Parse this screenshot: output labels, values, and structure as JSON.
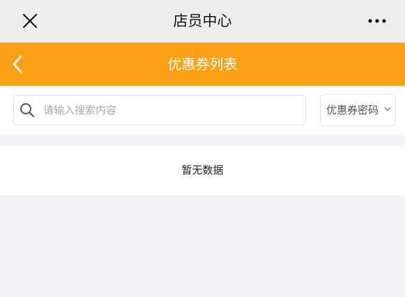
{
  "topbar": {
    "title": "店员中心",
    "close_icon": "close-icon",
    "more_icon": "more-dots-icon"
  },
  "header": {
    "title": "优惠券列表",
    "back_icon": "chevron-left-icon",
    "background": "#fba012"
  },
  "search": {
    "placeholder": "请输入搜索内容",
    "value": "",
    "icon": "search-icon"
  },
  "filter": {
    "selected": "优惠券密码",
    "icon": "chevron-down-icon"
  },
  "empty": {
    "message": "暂无数据"
  }
}
